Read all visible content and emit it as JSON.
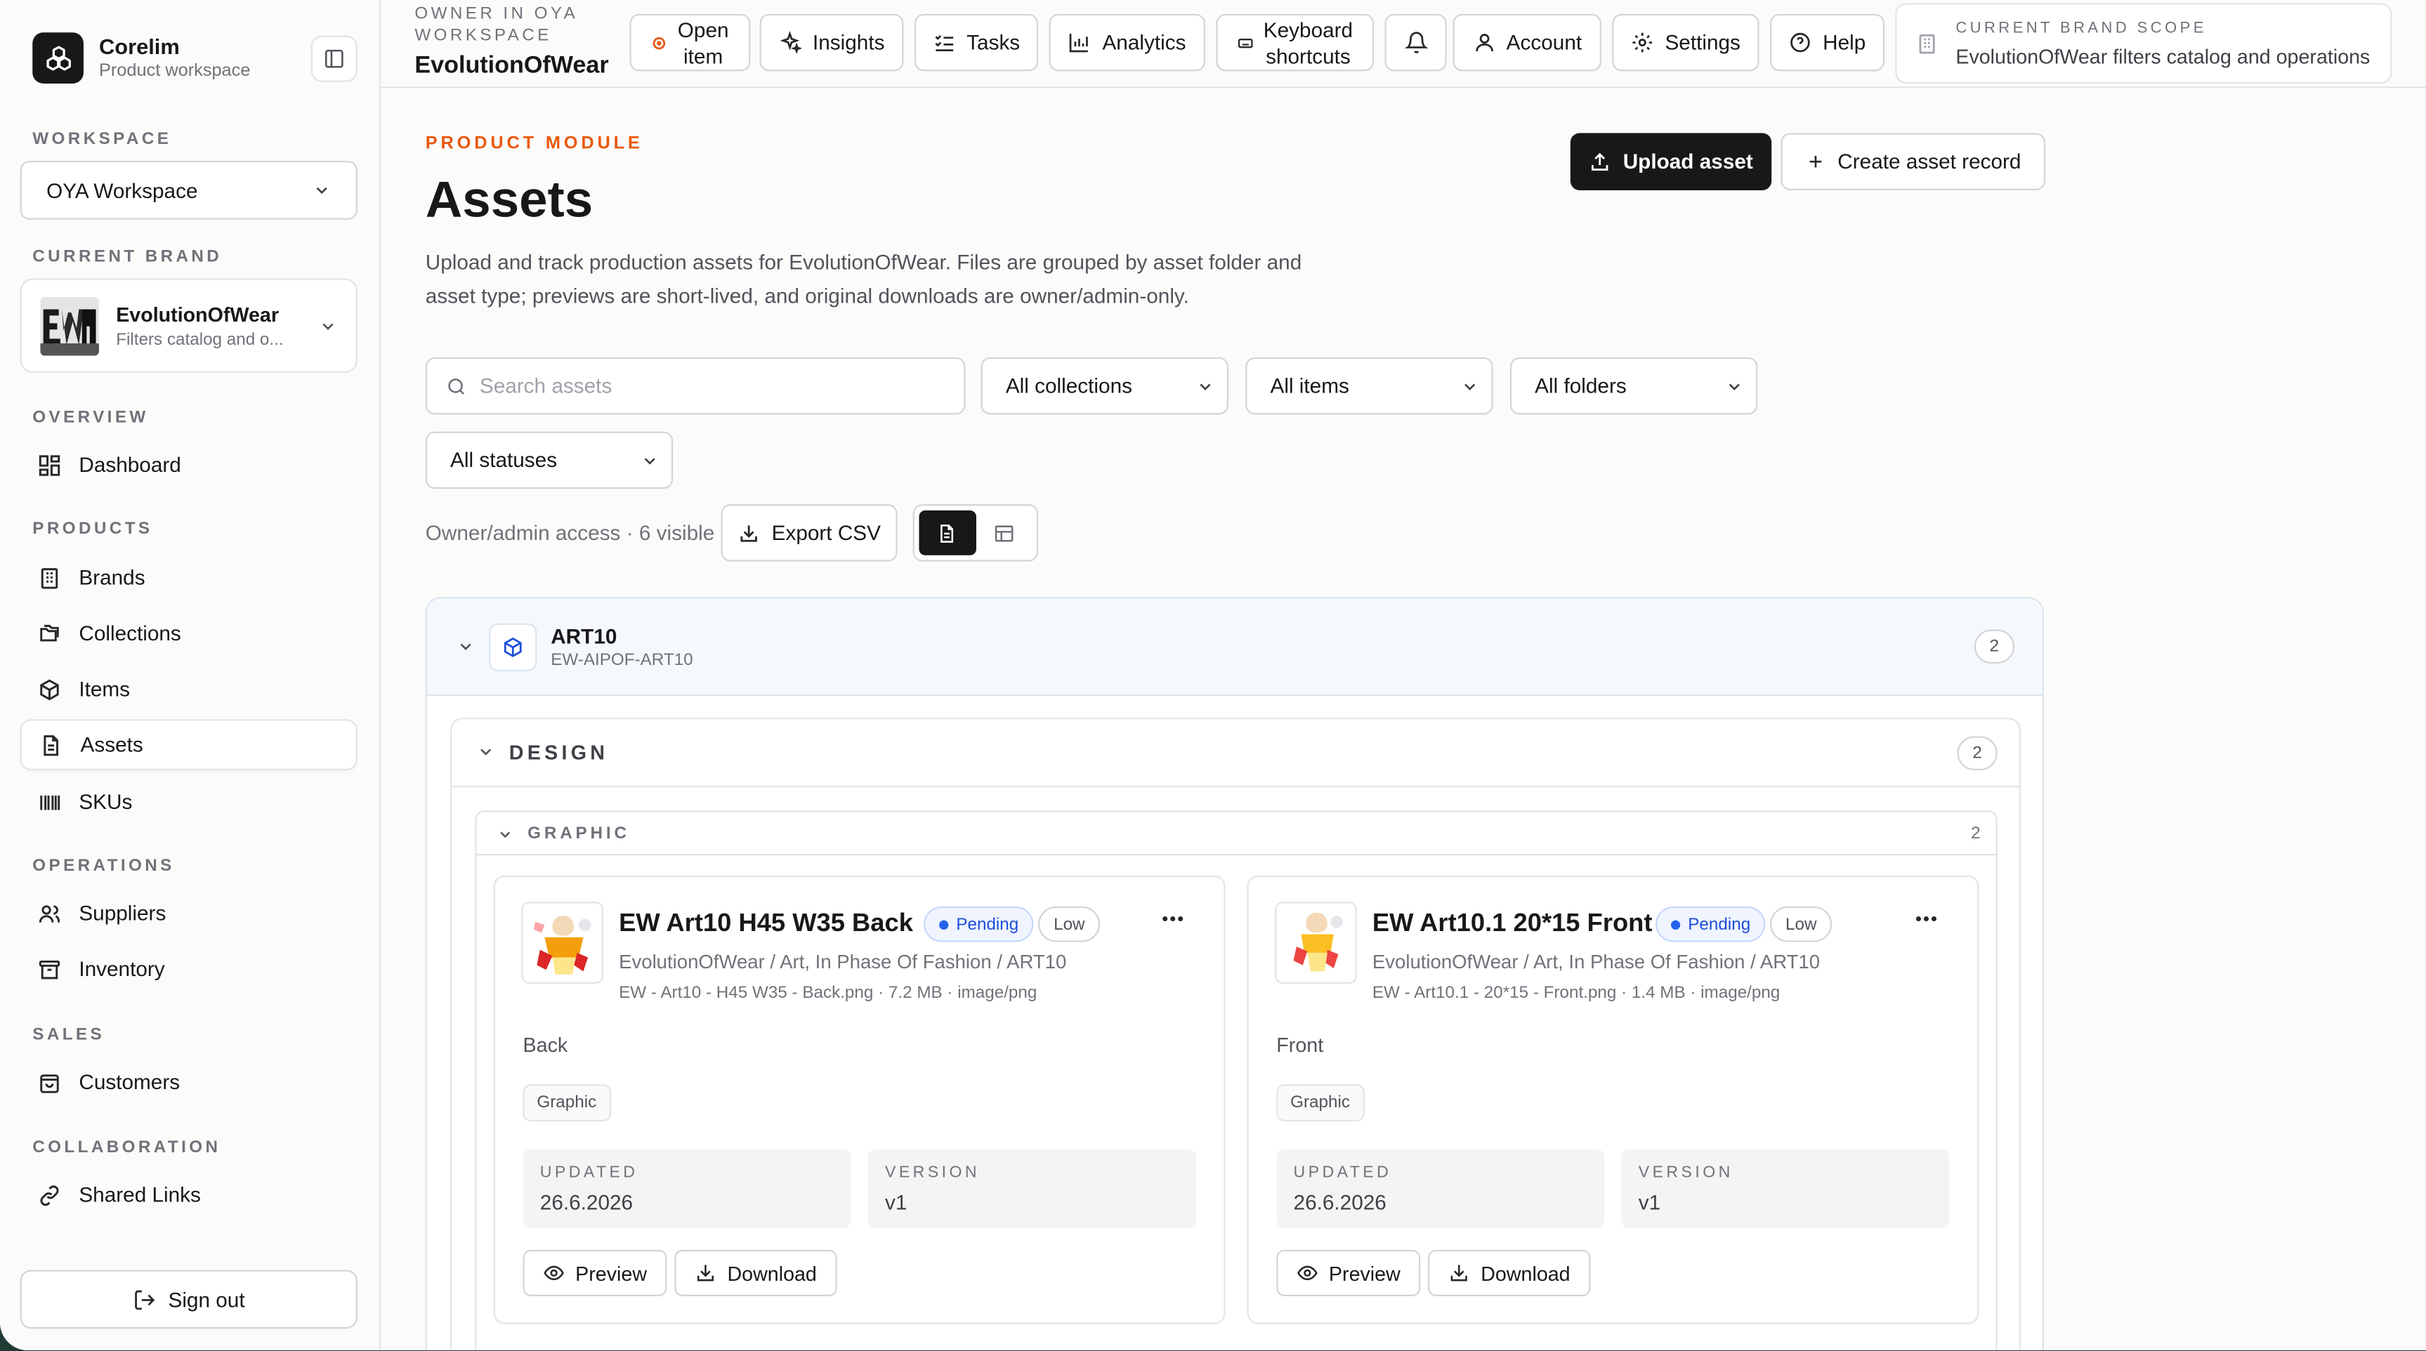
{
  "app": {
    "name": "Corelim",
    "subtitle": "Product workspace"
  },
  "sidebar": {
    "workspace_label": "WORKSPACE",
    "workspace_value": "OYA Workspace",
    "brand_label": "CURRENT BRAND",
    "brand_name": "EvolutionOfWear",
    "brand_desc": "Filters catalog and o...",
    "sections": {
      "overview": "OVERVIEW",
      "products": "PRODUCTS",
      "operations": "OPERATIONS",
      "sales": "SALES",
      "collaboration": "COLLABORATION"
    },
    "items": {
      "dashboard": "Dashboard",
      "brands": "Brands",
      "collections": "Collections",
      "items": "Items",
      "assets": "Assets",
      "skus": "SKUs",
      "suppliers": "Suppliers",
      "inventory": "Inventory",
      "customers": "Customers",
      "shared_links": "Shared Links"
    },
    "sign_out": "Sign out"
  },
  "topbar": {
    "owner_label": "OWNER IN OYA WORKSPACE",
    "owner_name": "EvolutionOfWear",
    "open_item_1": "Open",
    "open_item_2": "item",
    "insights": "Insights",
    "tasks": "Tasks",
    "analytics": "Analytics",
    "shortcuts_1": "Keyboard",
    "shortcuts_2": "shortcuts",
    "account": "Account",
    "settings": "Settings",
    "help": "Help",
    "scope_label": "CURRENT BRAND SCOPE",
    "scope_value": "EvolutionOfWear filters catalog and operations"
  },
  "page": {
    "eyebrow": "PRODUCT MODULE",
    "title": "Assets",
    "description": "Upload and track production assets for EvolutionOfWear. Files are grouped by asset folder and asset type; previews are short-lived, and original downloads are owner/admin-only.",
    "upload_button": "Upload asset",
    "create_button": "Create asset record"
  },
  "filters": {
    "search_placeholder": "Search assets",
    "collections": "All collections",
    "items": "All items",
    "folders": "All folders",
    "statuses": "All statuses"
  },
  "toolbar": {
    "access_text": "Owner/admin access · 6 visible",
    "export_csv": "Export CSV"
  },
  "group": {
    "title": "ART10",
    "code": "EW-AIPOF-ART10",
    "count": "2",
    "folder": {
      "title": "DESIGN",
      "count": "2",
      "type": {
        "title": "GRAPHIC",
        "count": "2",
        "assets": [
          {
            "title": "EW Art10 H45 W35 Back",
            "status": "Pending",
            "priority": "Low",
            "path": "EvolutionOfWear / Art, In Phase Of Fashion / ART10",
            "meta": "EW - Art10 - H45 W35 - Back.png · 7.2 MB · image/png",
            "note": "Back",
            "tag": "Graphic",
            "updated_label": "UPDATED",
            "updated": "26.6.2026",
            "version_label": "VERSION",
            "version": "v1",
            "preview": "Preview",
            "download": "Download"
          },
          {
            "title": "EW Art10.1 20*15 Front",
            "status": "Pending",
            "priority": "Low",
            "path": "EvolutionOfWear / Art, In Phase Of Fashion / ART10",
            "meta": "EW - Art10.1 - 20*15 - Front.png · 1.4 MB · image/png",
            "note": "Front",
            "tag": "Graphic",
            "updated_label": "UPDATED",
            "updated": "26.6.2026",
            "version_label": "VERSION",
            "version": "v1",
            "preview": "Preview",
            "download": "Download"
          }
        ]
      }
    }
  },
  "colors": {
    "accent": "#ea580c",
    "primary": "#18181b",
    "pending": "#1d4ed8",
    "background": "#fbfbfa"
  }
}
